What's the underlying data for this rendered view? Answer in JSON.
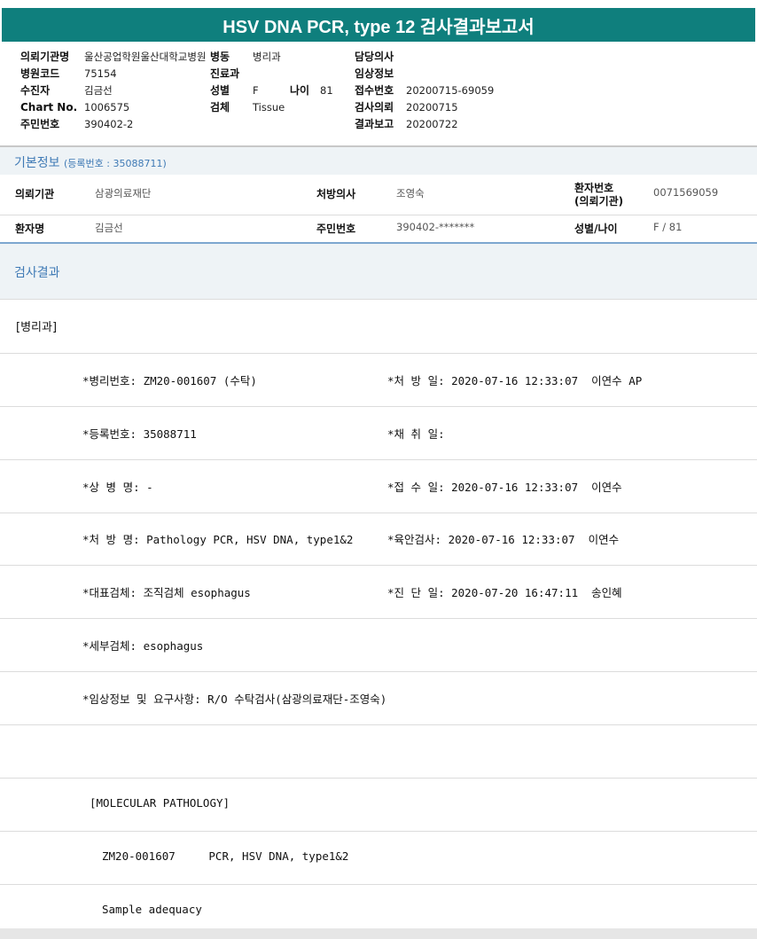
{
  "title": "HSV DNA PCR, type 12 검사결과보고서",
  "header": {
    "col1": [
      {
        "label": "의뢰기관명",
        "value": "울산공업학원울산대학교병원"
      },
      {
        "label": "병원코드",
        "value": "75154"
      },
      {
        "label": "수진자",
        "value": "김금선"
      },
      {
        "label": "Chart No.",
        "value": "1006575"
      },
      {
        "label": "주민번호",
        "value": "390402-2"
      }
    ],
    "col2": [
      {
        "label": "병동",
        "value": "병리과"
      },
      {
        "label": "진료과",
        "value": ""
      },
      {
        "label": "성별",
        "value": "F"
      },
      {
        "label": "검체",
        "value": "Tissue"
      }
    ],
    "age": {
      "label": "나이",
      "value": "81"
    },
    "col3": [
      {
        "label": "담당의사",
        "value": ""
      },
      {
        "label": "임상정보",
        "value": ""
      },
      {
        "label": "접수번호",
        "value": "20200715-69059"
      },
      {
        "label": "검사의뢰",
        "value": "20200715"
      },
      {
        "label": "결과보고",
        "value": "20200722"
      }
    ]
  },
  "basic_info": {
    "title": "기본정보",
    "subtitle": "(등록번호 : 35088711)",
    "row1": {
      "k1": "의뢰기관",
      "v1": "삼광의료재단",
      "k2": "처방의사",
      "v2": "조영숙",
      "k3": "환자번호",
      "k3b": "(의뢰기관)",
      "v3": "0071569059"
    },
    "row2": {
      "k1": "환자명",
      "v1": "김금선",
      "k2": "주민번호",
      "v2": "390402-*******",
      "k3": "성별/나이",
      "v3": "F / 81"
    }
  },
  "results": {
    "title": "검사결과",
    "dept": "[병리과]",
    "rows": [
      {
        "left": "*병리번호: ZM20-001607 (수탁)",
        "right": "*처 방 일: 2020-07-16 12:33:07  이연수 AP"
      },
      {
        "left": "*등록번호: 35088711",
        "right": "*채 취 일:"
      },
      {
        "left": "*상 병 명: -",
        "right": "*접 수 일: 2020-07-16 12:33:07  이연수"
      },
      {
        "left": "*처 방 명: Pathology PCR, HSV DNA, type1&2",
        "right": "*육안검사: 2020-07-16 12:33:07  이연수"
      },
      {
        "left": "*대표검체: 조직검체 esophagus",
        "right": "*진 단 일: 2020-07-20 16:47:11  송인혜"
      },
      {
        "left": "*세부검체: esophagus",
        "right": ""
      },
      {
        "left": "*임상정보 및 요구사항: R/O 수탁검사(삼광의료재단-조영숙)",
        "right": ""
      }
    ],
    "molecular": "[MOLECULAR PATHOLOGY]",
    "molecular_line": "ZM20-001607     PCR, HSV DNA, type1&2",
    "sample": "Sample adequacy"
  }
}
